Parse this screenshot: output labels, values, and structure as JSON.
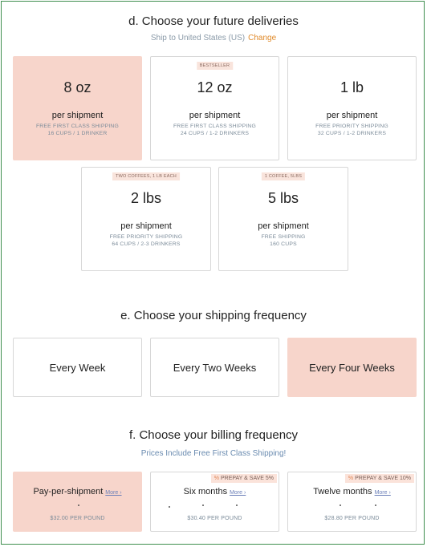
{
  "deliveries": {
    "title": "d. Choose your future deliveries",
    "ship_to": "Ship to United States (US)",
    "change_label": "Change",
    "options": [
      {
        "badge": "",
        "size": "8 oz",
        "per": "per shipment",
        "shipping": "FREE FIRST CLASS SHIPPING",
        "cups": "16 CUPS / 1 DRINKER",
        "selected": true
      },
      {
        "badge": "BESTSELLER",
        "size": "12 oz",
        "per": "per shipment",
        "shipping": "FREE FIRST CLASS SHIPPING",
        "cups": "24 CUPS / 1-2 DRINKERS",
        "selected": false
      },
      {
        "badge": "",
        "size": "1 lb",
        "per": "per shipment",
        "shipping": "FREE PRIORITY SHIPPING",
        "cups": "32 CUPS / 1-2 DRINKERS",
        "selected": false
      },
      {
        "badge": "TWO COFFEES, 1 LB EACH",
        "size": "2 lbs",
        "per": "per shipment",
        "shipping": "FREE PRIORITY SHIPPING",
        "cups": "64 CUPS / 2-3 DRINKERS",
        "selected": false
      },
      {
        "badge": "1 COFFEE, 5LBS",
        "size": "5 lbs",
        "per": "per shipment",
        "shipping": "FREE SHIPPING",
        "cups": "160 CUPS",
        "selected": false
      }
    ]
  },
  "frequency": {
    "title": "e. Choose your shipping frequency",
    "options": [
      {
        "label": "Every Week",
        "selected": false
      },
      {
        "label": "Every Two Weeks",
        "selected": false
      },
      {
        "label": "Every Four Weeks",
        "selected": true
      }
    ]
  },
  "billing": {
    "title": "f. Choose your billing frequency",
    "subtitle": "Prices Include Free First Class Shipping!",
    "options": [
      {
        "label": "Pay-per-shipment",
        "more": "More ›",
        "save": "",
        "price": "$32.00 PER POUND",
        "selected": true
      },
      {
        "label": "Six months",
        "more": "More ›",
        "save": "PREPAY & SAVE 5%",
        "price": "$30.40 PER POUND",
        "selected": false
      },
      {
        "label": "Twelve months",
        "more": "More ›",
        "save": "PREPAY & SAVE 10%",
        "price": "$28.80 PER POUND",
        "selected": false
      }
    ]
  },
  "colors": {
    "selected_bg": "#f7d5cb",
    "border_green": "#3f8f4f",
    "link_orange": "#e08a2a"
  }
}
